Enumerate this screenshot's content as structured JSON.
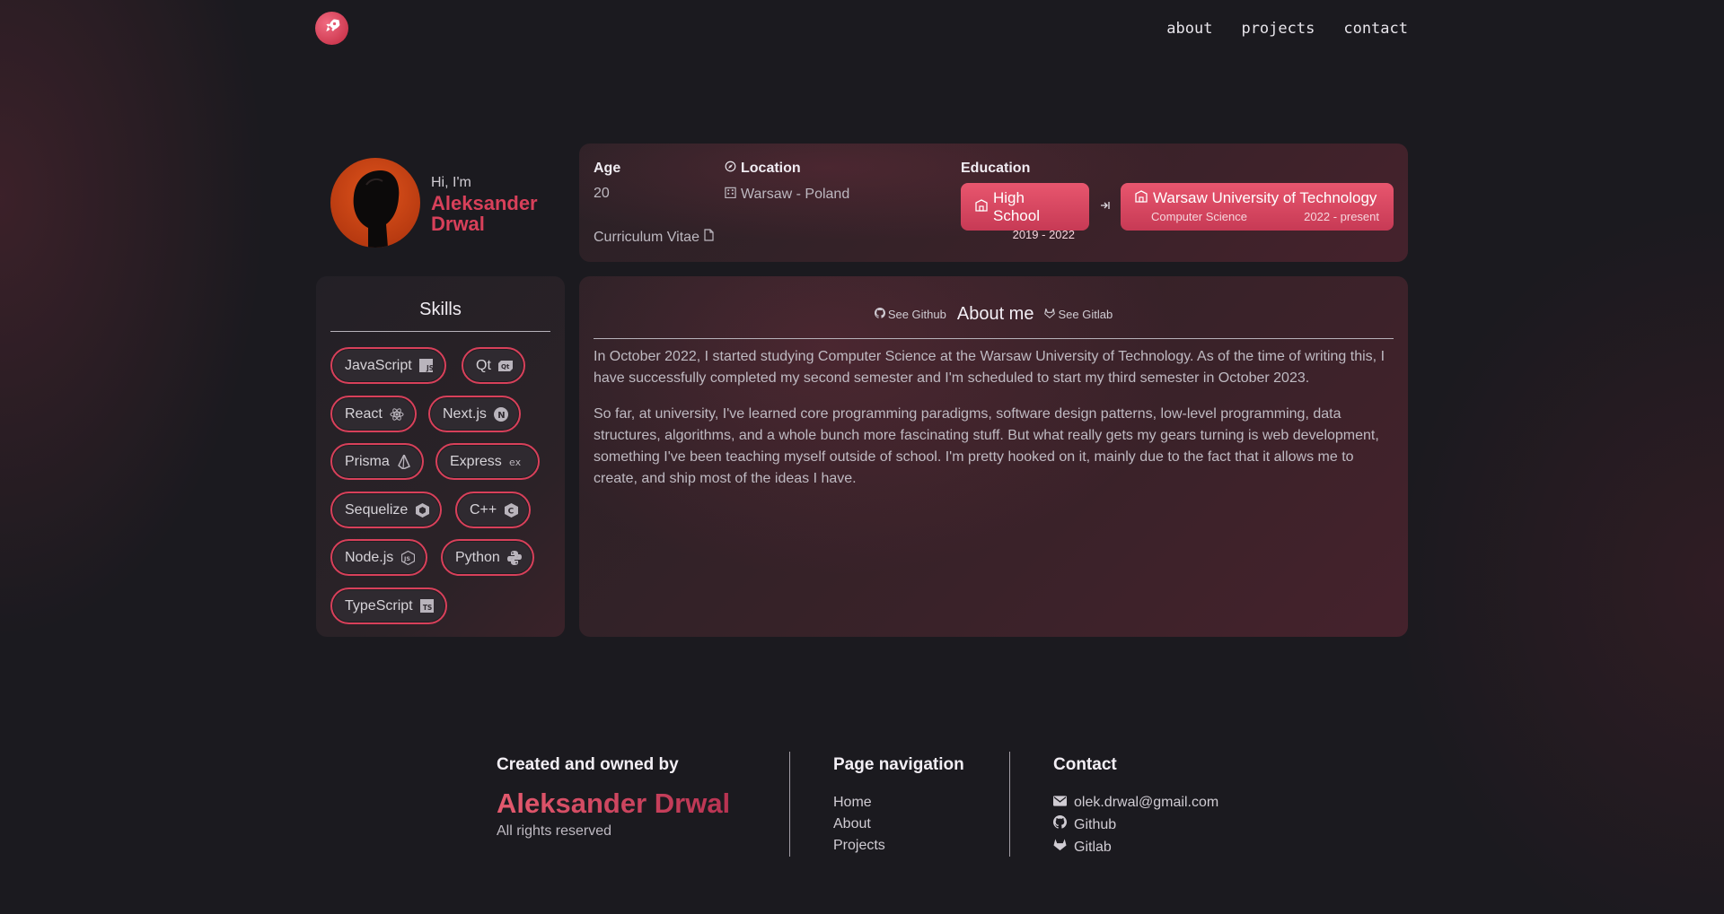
{
  "nav": {
    "logo_icon": "rocket-icon",
    "links": [
      "about",
      "projects",
      "contact"
    ]
  },
  "intro": {
    "greeting": "Hi, I'm",
    "name_line1": "Aleksander",
    "name_line2": "Drwal",
    "avatar_icon": "portrait-avatar"
  },
  "info": {
    "age_label": "Age",
    "age_value": "20",
    "location_label": "Location",
    "location_value": "Warsaw - Poland",
    "cv_label": "Curriculum Vitae",
    "education_label": "Education",
    "education": [
      {
        "title": "High School",
        "subtitle": "",
        "years": "2019 - 2022"
      },
      {
        "title": "Warsaw University of Technology",
        "subtitle": "Computer Science",
        "years": "2022 - present"
      }
    ]
  },
  "skills": {
    "title": "Skills",
    "items": [
      {
        "label": "JavaScript",
        "icon": "javascript-icon"
      },
      {
        "label": "Qt",
        "icon": "qt-icon"
      },
      {
        "label": "React",
        "icon": "react-icon"
      },
      {
        "label": "Next.js",
        "icon": "nextjs-icon"
      },
      {
        "label": "Prisma",
        "icon": "prisma-icon"
      },
      {
        "label": "Express",
        "icon": "express-icon"
      },
      {
        "label": "Sequelize",
        "icon": "sequelize-icon"
      },
      {
        "label": "C++",
        "icon": "cpp-icon"
      },
      {
        "label": "Node.js",
        "icon": "nodejs-icon"
      },
      {
        "label": "Python",
        "icon": "python-icon"
      },
      {
        "label": "TypeScript",
        "icon": "typescript-icon"
      }
    ]
  },
  "about": {
    "github_link": "See Github",
    "title": "About me",
    "gitlab_link": "See Gitlab",
    "paragraphs": [
      "In October 2022, I started studying Computer Science at the Warsaw University of Technology. As of the time of writing this, I have successfully completed my second semester and I'm scheduled to start my third semester in October 2023.",
      "So far, at university, I've learned core programming paradigms, software design patterns, low-level programming, data structures, algorithms, and a whole bunch more fascinating stuff. But what really gets my gears turning is web development, something I've been teaching myself outside of school. I'm pretty hooked on it, mainly due to the fact that it allows me to create, and ship most of the ideas I have."
    ]
  },
  "footer": {
    "created_heading": "Created and owned by",
    "owner_name": "Aleksander Drwal",
    "rights": "All rights reserved",
    "nav_heading": "Page navigation",
    "nav_links": [
      "Home",
      "About",
      "Projects"
    ],
    "contact_heading": "Contact",
    "contacts": [
      {
        "label": "olek.drwal@gmail.com",
        "icon": "mail-icon"
      },
      {
        "label": "Github",
        "icon": "github-icon"
      },
      {
        "label": "Gitlab",
        "icon": "gitlab-icon"
      }
    ]
  },
  "colors": {
    "accent": "#d8405a",
    "background": "#1b1a1f",
    "card": "#3a2229"
  }
}
